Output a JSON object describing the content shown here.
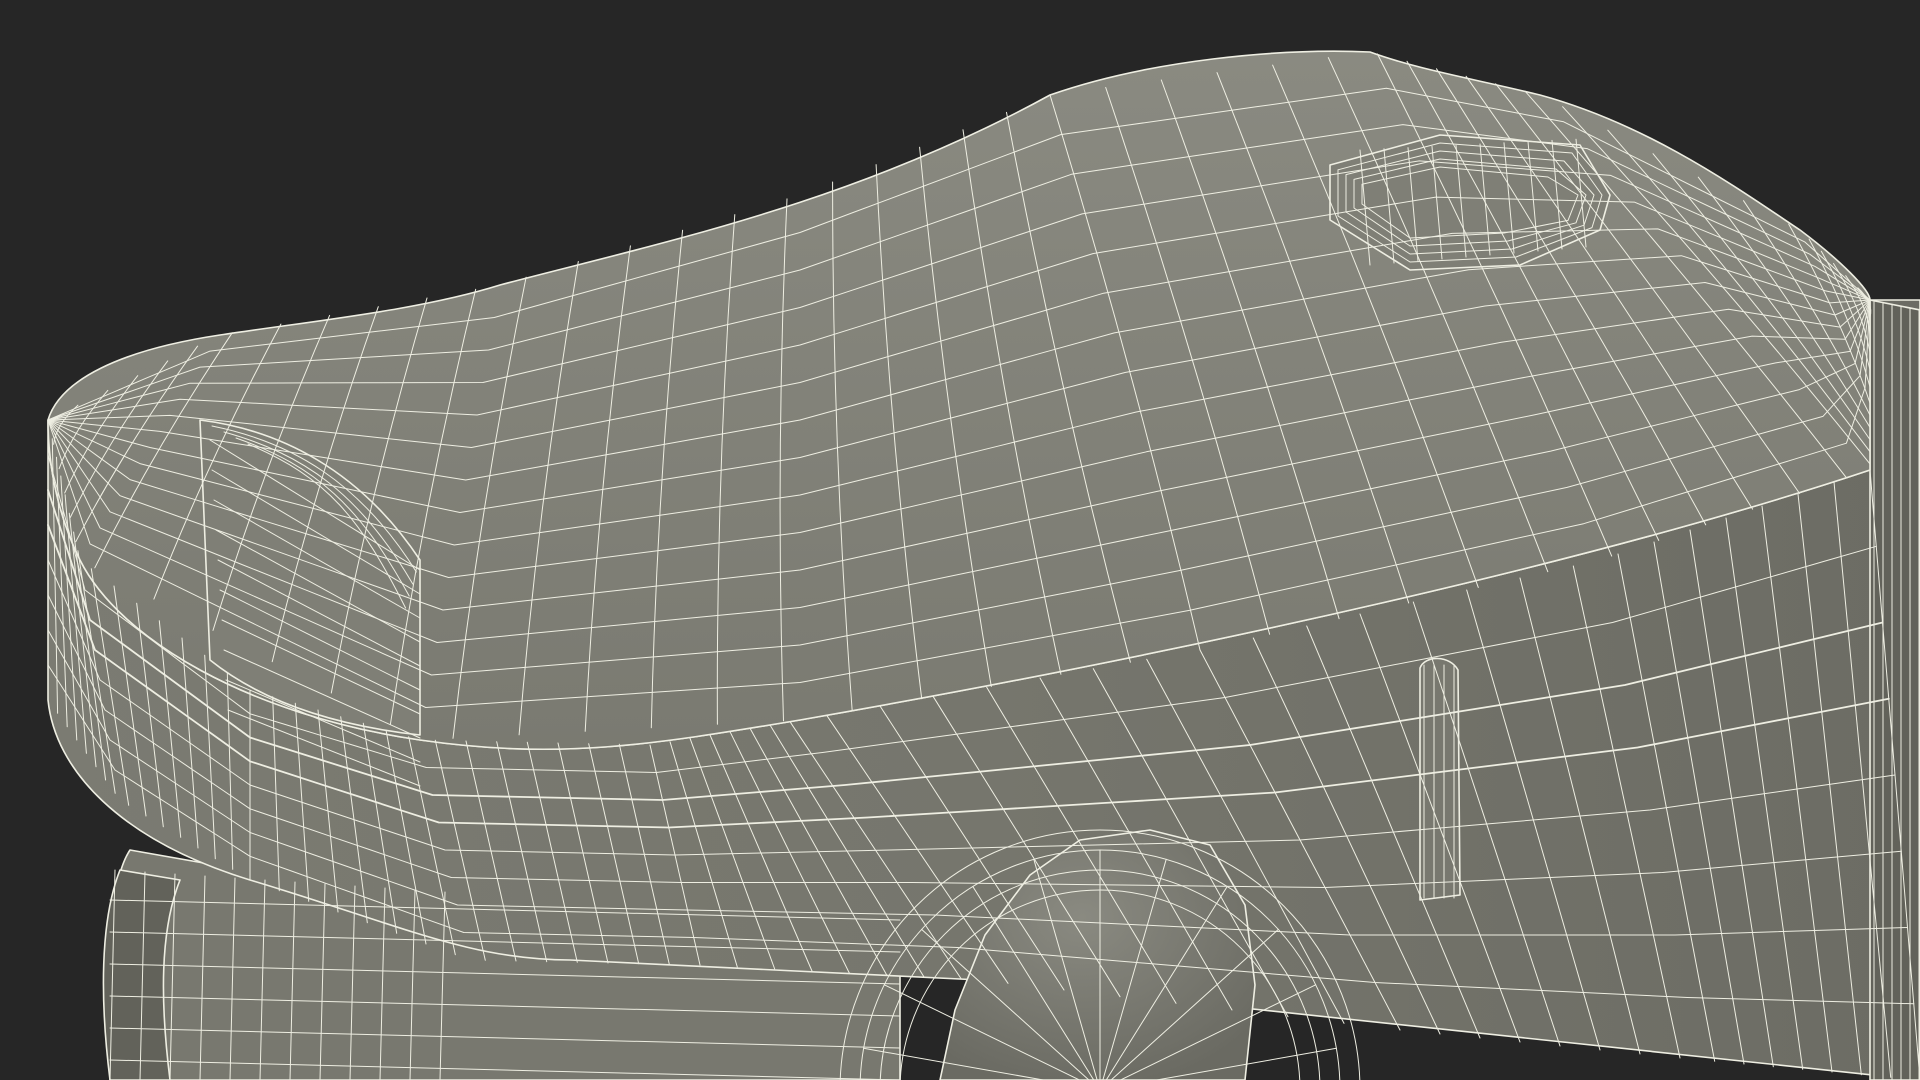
{
  "scene": {
    "background_color": "#262626",
    "surface_top_color": "#7f7f76",
    "surface_front_color": "#78786f",
    "surface_shadow_color": "#62625a",
    "wire_color": "#eeeee2",
    "object": "wireframe-3d-model"
  }
}
